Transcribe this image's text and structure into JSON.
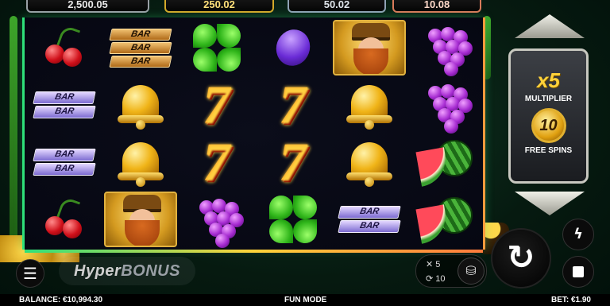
{
  "jackpots": {
    "grand": "2,500.05",
    "major": "250.02",
    "minor": "50.02",
    "mini": "10.08"
  },
  "reels": [
    [
      "cherry",
      "bar-purple-2",
      "bar-purple-2",
      "cherry"
    ],
    [
      "bar-gold-3",
      "bell",
      "bell",
      "wild"
    ],
    [
      "clover",
      "seven",
      "seven",
      "grapes"
    ],
    [
      "plum",
      "seven",
      "seven",
      "clover"
    ],
    [
      "wild",
      "bell",
      "bell",
      "bar-purple-2"
    ],
    [
      "grapes",
      "grapes",
      "watermelon",
      "watermelon"
    ]
  ],
  "symbols": {
    "bar_label": "BAR",
    "seven_label": "7"
  },
  "bonus_panel": {
    "multiplier": "x5",
    "multiplier_label": "MULTIPLIER",
    "free_spins_count": "10",
    "free_spins_label": "FREE SPINS"
  },
  "branding": {
    "logo_hyper": "Hyper",
    "logo_bonus": "BONUS"
  },
  "bet_panel": {
    "multiplier_value": "✕ 5",
    "spins_value": "⟳ 10"
  },
  "footer": {
    "balance": "BALANCE: €10,994.30",
    "mode": "FUN MODE",
    "bet": "BET: €1.90"
  },
  "colors": {
    "accent_gold": "#ffd23a",
    "frame_green": "#2ee07a",
    "frame_orange": "#ff9a3c"
  },
  "icons": {
    "menu": "hamburger-menu-icon",
    "spin": "spin-arrow-icon",
    "turbo": "lightning-icon",
    "stop": "stop-icon",
    "coins": "coin-stack-icon"
  }
}
